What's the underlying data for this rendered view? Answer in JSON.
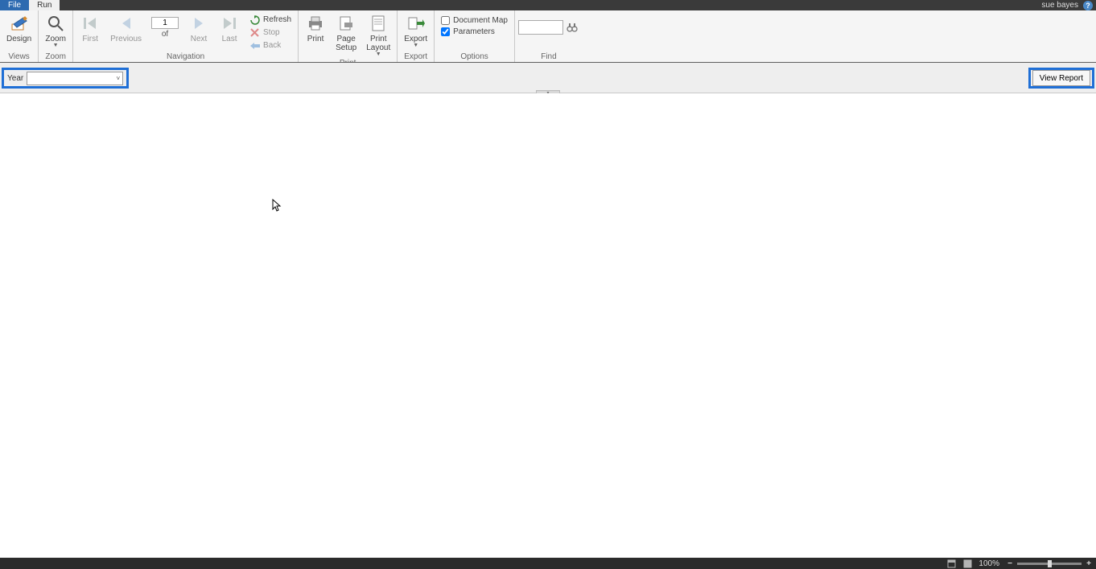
{
  "title_user": "sue bayes",
  "tabs": {
    "file": "File",
    "run": "Run"
  },
  "ribbon": {
    "views": {
      "design": "Design",
      "group": "Views"
    },
    "zoom": {
      "zoom": "Zoom",
      "group": "Zoom"
    },
    "navigation": {
      "first": "First",
      "previous": "Previous",
      "next": "Next",
      "last": "Last",
      "page_current": "1",
      "page_of": "of",
      "refresh": "Refresh",
      "stop": "Stop",
      "back": "Back",
      "group": "Navigation"
    },
    "print": {
      "print": "Print",
      "page_setup_l1": "Page",
      "page_setup_l2": "Setup",
      "layout_l1": "Print",
      "layout_l2": "Layout",
      "group": "Print"
    },
    "export": {
      "export": "Export",
      "group": "Export"
    },
    "options": {
      "docmap": "Document Map",
      "params": "Parameters",
      "group": "Options"
    },
    "find": {
      "group": "Find",
      "value": ""
    }
  },
  "params": {
    "year_label": "Year",
    "view_report": "View Report"
  },
  "status": {
    "zoom_pct": "100%"
  }
}
